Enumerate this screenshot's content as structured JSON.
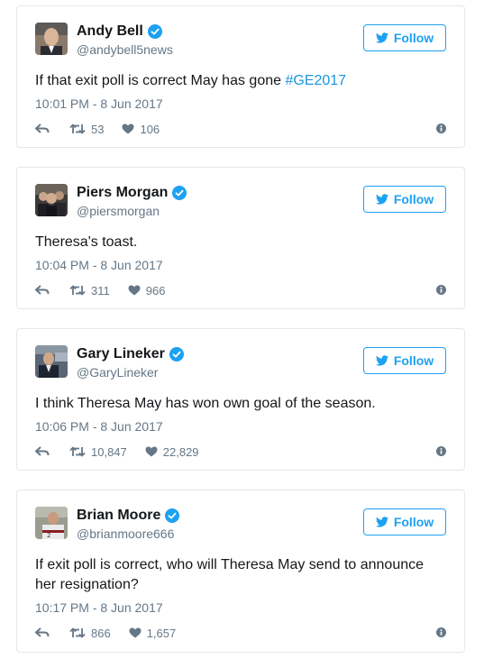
{
  "colors": {
    "accent": "#1da1f2",
    "hashtag": "#1b95e0",
    "muted": "#657786",
    "text": "#14171a",
    "border": "#e1e8ed"
  },
  "icons": {
    "verified": "verified-badge-icon",
    "follow": "twitter-bird-icon",
    "reply": "reply-icon",
    "retweet": "retweet-icon",
    "like": "heart-icon",
    "info": "info-icon"
  },
  "tweets": [
    {
      "author": "Andy Bell",
      "handle": "@andybell5news",
      "follow_label": "Follow",
      "text": "If that exit poll is correct May has gone ",
      "hashtag": "#GE2017",
      "time": "10:01 PM - 8 Jun 2017",
      "retweets": "53",
      "likes": "106"
    },
    {
      "author": "Piers Morgan",
      "handle": "@piersmorgan",
      "follow_label": "Follow",
      "text": "Theresa's toast.",
      "hashtag": "",
      "time": "10:04 PM - 8 Jun 2017",
      "retweets": "311",
      "likes": "966"
    },
    {
      "author": "Gary Lineker",
      "handle": "@GaryLineker",
      "follow_label": "Follow",
      "text": "I think Theresa May has won own goal of the season.",
      "hashtag": "",
      "time": "10:06 PM - 8 Jun 2017",
      "retweets": "10,847",
      "likes": "22,829"
    },
    {
      "author": "Brian Moore",
      "handle": "@brianmoore666",
      "follow_label": "Follow",
      "text": "If exit poll is correct, who will Theresa May send to announce her resignation?",
      "hashtag": "",
      "time": "10:17 PM - 8 Jun 2017",
      "retweets": "866",
      "likes": "1,657"
    }
  ]
}
